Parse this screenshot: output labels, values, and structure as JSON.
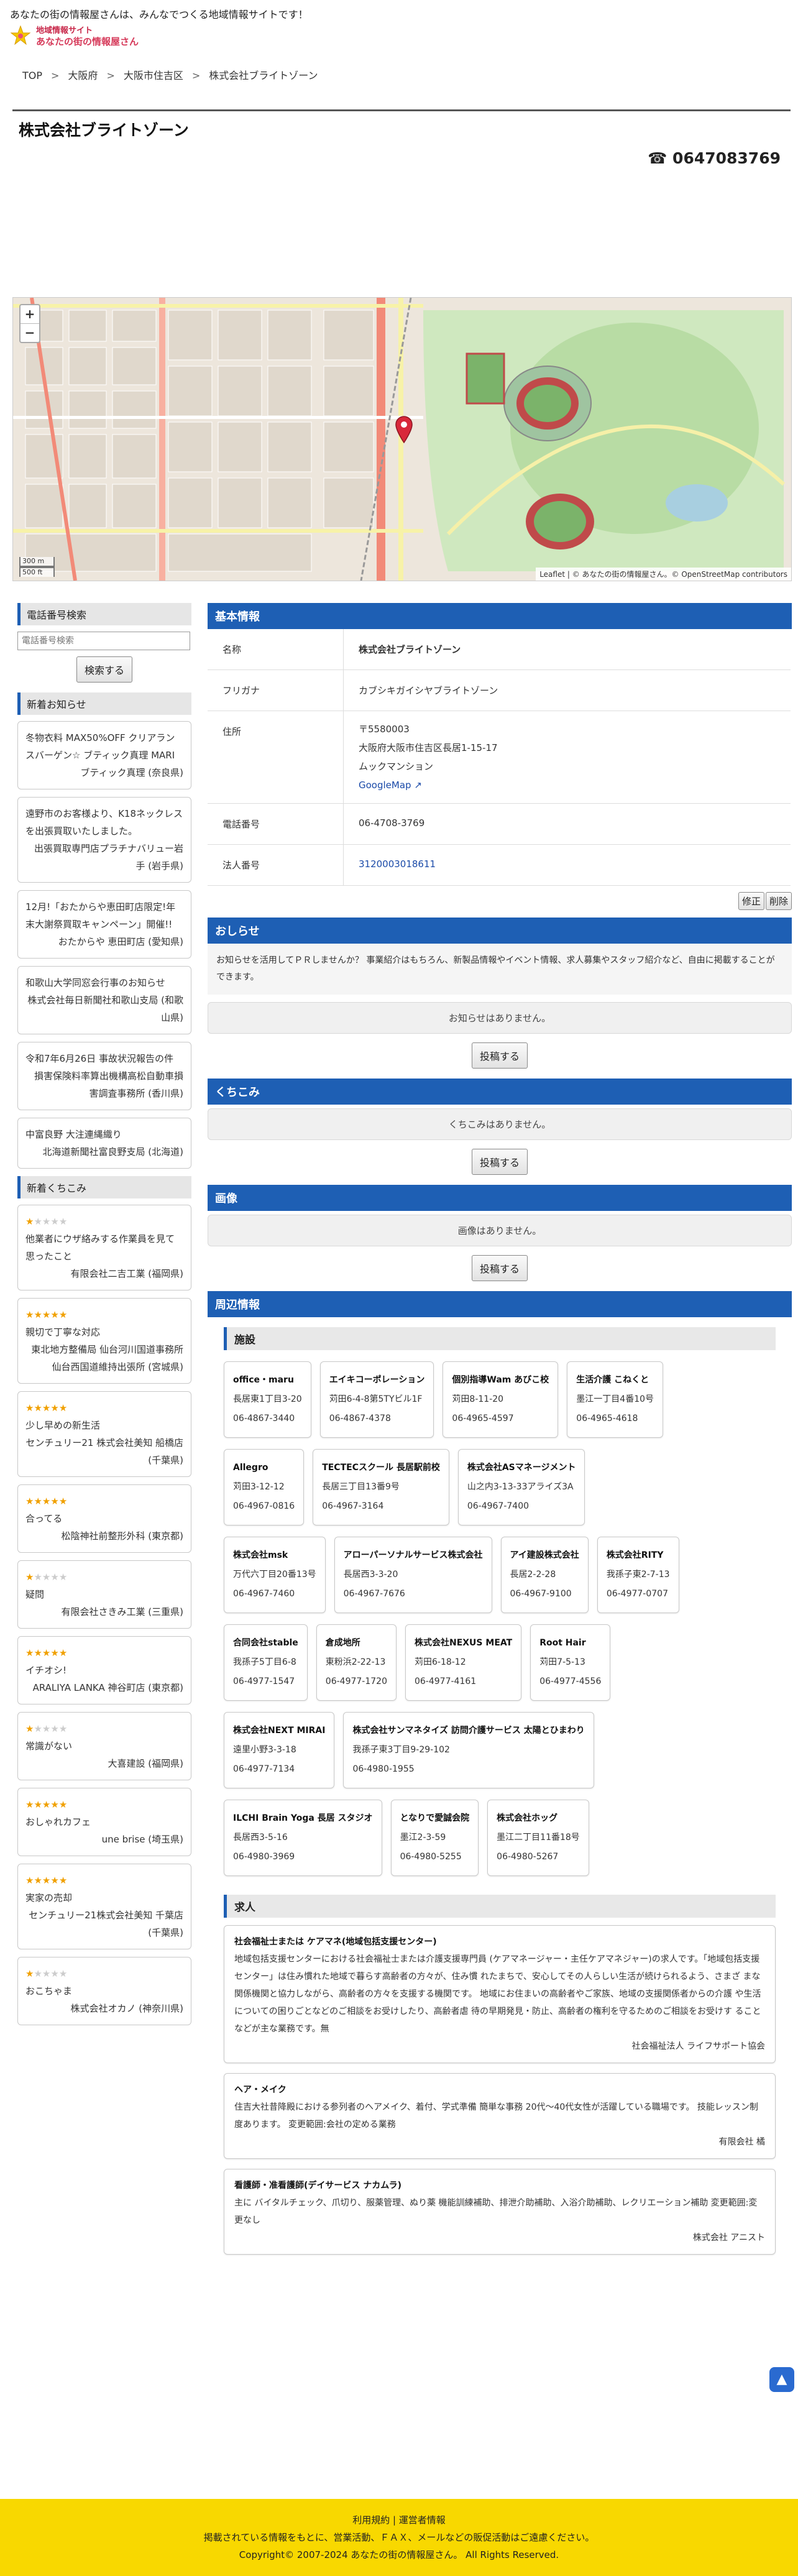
{
  "header": {
    "tagline": "あなたの街の情報屋さんは、みんなでつくる地域情報サイトです！",
    "logo_line1": "地域情報サイト",
    "logo_line2": "あなたの街の情報屋さん"
  },
  "breadcrumb": [
    "TOP",
    "大阪府",
    "大阪市住吉区",
    "株式会社ブライトゾーン"
  ],
  "company": {
    "name": "株式会社ブライトゾーン",
    "phone_display": "☎ 0647083769"
  },
  "map": {
    "zoom_in": "+",
    "zoom_out": "−",
    "scale_m": "300 m",
    "scale_ft": "500 ft",
    "attribution": "Leaflet | © あなたの街の情報屋さん。© OpenStreetMap contributors"
  },
  "sidebar": {
    "phone_search_title": "電話番号検索",
    "phone_search_placeholder": "電話番号検索",
    "search_button": "検索する",
    "news_title": "新着お知らせ",
    "news": [
      {
        "text": "冬物衣料 MAX50%OFF クリアランスバーゲン☆ ブティック真理 MARI",
        "src": "ブティック真理 (奈良県)"
      },
      {
        "text": "遠野市のお客様より、K18ネックレスを出張買取いたしました。",
        "src": "出張買取専門店プラチナバリュー岩手 (岩手県)"
      },
      {
        "text": "12月!「おたからや恵田町店限定!年末大謝祭買取キャンペーン」開催!!",
        "src": "おたからや 恵田町店 (愛知県)"
      },
      {
        "text": "和歌山大学同窓会行事のお知らせ",
        "src": "株式会社毎日新聞社和歌山支局 (和歌山県)"
      },
      {
        "text": "令和7年6月26日 事故状況報告の件",
        "src": "損害保険料率算出機構高松自動車損害調査事務所 (香川県)"
      },
      {
        "text": "中富良野 大注連縄織り",
        "src": "北海道新聞社富良野支局 (北海道)"
      }
    ],
    "kuchikomi_title": "新着くちこみ",
    "kuchikomi": [
      {
        "stars": 1,
        "text": "他業者にウザ絡みする作業員を見て思ったこと",
        "src": "有限会社二吉工業 (福岡県)"
      },
      {
        "stars": 5,
        "text": "親切で丁寧な対応",
        "src": "東北地方整備局 仙台河川国道事務所 仙台西国道維持出張所 (宮城県)"
      },
      {
        "stars": 5,
        "text": "少し早めの新生活",
        "src": "センチュリー21 株式会社美知 船橋店 (千葉県)"
      },
      {
        "stars": 5,
        "text": "合ってる",
        "src": "松陰神社前整形外科 (東京都)"
      },
      {
        "stars": 1,
        "text": "疑問",
        "src": "有限会社さきみ工業 (三重県)"
      },
      {
        "stars": 5,
        "text": "イチオシ!",
        "src": "ARALIYA LANKA 神谷町店 (東京都)"
      },
      {
        "stars": 1,
        "text": "常識がない",
        "src": "大喜建設 (福岡県)"
      },
      {
        "stars": 5,
        "text": "おしゃれカフェ",
        "src": "une brise (埼玉県)"
      },
      {
        "stars": 5,
        "text": "実家の売却",
        "src": "センチュリー21株式会社美知 千葉店 (千葉県)"
      },
      {
        "stars": 1,
        "text": "おこちゃま",
        "src": "株式会社オカノ (神奈川県)"
      }
    ]
  },
  "basic": {
    "title": "基本情報",
    "rows": [
      {
        "label": "名称",
        "value": "株式会社ブライトゾーン"
      },
      {
        "label": "フリガナ",
        "value": "カブシキガイシヤブライトゾーン"
      },
      {
        "label": "住所",
        "zip": "〒5580003",
        "addr1": "大阪府大阪市住吉区長居1-15-17",
        "addr2": "ムックマンション",
        "map_link": "GoogleMap"
      },
      {
        "label": "電話番号",
        "value": "06-4708-3769"
      },
      {
        "label": "法人番号",
        "value": "3120003018611"
      }
    ],
    "edit_button": "修正",
    "delete_button": "削除"
  },
  "oshirase": {
    "title": "おしらせ",
    "desc": "お知らせを活用してＰＲしませんか？ 事業紹介はもちろん、新製品情報やイベント情報、求人募集やスタッフ紹介など、自由に掲載することができます。",
    "empty": "お知らせはありません。",
    "post_button": "投稿する"
  },
  "kuchikomi": {
    "title": "くちこみ",
    "empty": "くちこみはありません。",
    "post_button": "投稿する"
  },
  "images": {
    "title": "画像",
    "empty": "画像はありません。",
    "post_button": "投稿する"
  },
  "nearby": {
    "title": "周辺情報",
    "facilities_title": "施設",
    "facilities": [
      [
        {
          "name": "office・maru",
          "addr": "長居東1丁目3-20",
          "tel": "06-4867-3440"
        },
        {
          "name": "エイキコーポレーション",
          "addr": "苅田6-4-8第5TYビル1F",
          "tel": "06-4867-4378"
        },
        {
          "name": "個別指導Wam あびこ校",
          "addr": "苅田8-11-20",
          "tel": "06-4965-4597"
        },
        {
          "name": "生活介護 こねくと",
          "addr": "墨江一丁目4番10号",
          "tel": "06-4965-4618"
        }
      ],
      [
        {
          "name": "Allegro",
          "addr": "苅田3-12-12",
          "tel": "06-4967-0816"
        },
        {
          "name": "TECTECスクール 長居駅前校",
          "addr": "長居三丁目13番9号",
          "tel": "06-4967-3164"
        },
        {
          "name": "株式会社ASマネージメント",
          "addr": "山之内3-13-33アライズ3A",
          "tel": "06-4967-7400"
        }
      ],
      [
        {
          "name": "株式会社msk",
          "addr": "万代六丁目20番13号",
          "tel": "06-4967-7460"
        },
        {
          "name": "アローパーソナルサービス株式会社",
          "addr": "長居西3-3-20",
          "tel": "06-4967-7676"
        },
        {
          "name": "アイ建設株式会社",
          "addr": "長居2-2-28",
          "tel": "06-4967-9100"
        },
        {
          "name": "株式会社RITY",
          "addr": "我孫子東2-7-13",
          "tel": "06-4977-0707"
        }
      ],
      [
        {
          "name": "合同会社stable",
          "addr": "我孫子5丁目6-8",
          "tel": "06-4977-1547"
        },
        {
          "name": "倉成地所",
          "addr": "東粉浜2-22-13",
          "tel": "06-4977-1720"
        },
        {
          "name": "株式会社NEXUS MEAT",
          "addr": "苅田6-18-12",
          "tel": "06-4977-4161"
        },
        {
          "name": "Root Hair",
          "addr": "苅田7-5-13",
          "tel": "06-4977-4556"
        }
      ],
      [
        {
          "name": "株式会社NEXT MIRAI",
          "addr": "遠里小野3-3-18",
          "tel": "06-4977-7134"
        },
        {
          "name": "株式会社サンマネタイズ 訪問介護サービス 太陽とひまわり",
          "addr": "我孫子東3丁目9-29-102",
          "tel": "06-4980-1955"
        }
      ],
      [
        {
          "name": "ILCHI Brain Yoga 長居 スタジオ",
          "addr": "長居西3-5-16",
          "tel": "06-4980-3969"
        },
        {
          "name": "となりで愛誠会院",
          "addr": "墨江2-3-59",
          "tel": "06-4980-5255"
        },
        {
          "name": "株式会社ホッグ",
          "addr": "墨江二丁目11番18号",
          "tel": "06-4980-5267"
        }
      ]
    ],
    "jobs_title": "求人",
    "jobs": [
      {
        "name": "社会福祉士または ケアマネ(地域包括支援センター)",
        "desc": "地域包括支援センターにおける社会福祉士または介護支援専門員 (ケアマネージャー・主任ケアマネジャー)の求人です。「地域包括支援センター」は住み慣れた地域で暮らす高齢者の方々が、住み慣 れたまちで、安心してその人らしい生活が続けられるよう、さまざ まな関係機関と協力しながら、高齢者の方々を支援する機関です。 地域にお住まいの高齢者やご家族、地域の支援関係者からの介護 や生活についての困りごとなどのご相談をお受けしたり、高齢者虐 待の早期発見・防止、高齢者の権利を守るためのご相談をお受けす ることなどが主な業務です。無",
        "src": "社会福祉法人 ライフサポート協会"
      },
      {
        "name": "ヘア・メイク",
        "desc": "住吉大社昔降殿における参列者のヘアメイク、着付、学式準備 簡単な事務 20代〜40代女性が活躍している職場です。 技能レッスン制度あります。 変更範囲:会社の定める業務",
        "src": "有限会社 橘"
      },
      {
        "name": "看護師・准看護師(デイサービス ナカムラ)",
        "desc": "主に バイタルチェック、爪切り、服薬管理、ぬり薬 機能訓練補助、排泄介助補助、入浴介助補助、レクリエーション補助 変更範囲:変更なし",
        "src": "株式会社 アニスト"
      }
    ]
  },
  "footer": {
    "links": "利用規約 | 運営者情報",
    "notice": "掲載されている情報をもとに、営業活動、ＦＡＸ、メールなどの販促活動はご遠慮ください。",
    "copyright": "Copyright© 2007-2024 あなたの街の情報屋さん。 All Rights Reserved."
  },
  "to_top_label": "▲",
  "colors": {
    "accent": "#1e5fb4",
    "footer": "#f8d800",
    "star": "#f0a000"
  }
}
